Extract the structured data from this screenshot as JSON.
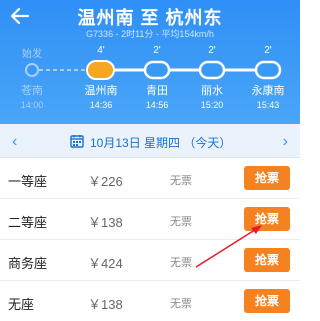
{
  "header": {
    "title": "温州南 至 杭州东",
    "subtitle": "G7336 - 2时11分 - 平均154km/h",
    "back_icon": "back-arrow-icon"
  },
  "route": {
    "stops": [
      {
        "name": "苍南",
        "time": "14:00",
        "stay": "始发",
        "passed": true
      },
      {
        "name": "温州南",
        "time": "14:36",
        "stay": "4'",
        "passed": false,
        "current": true
      },
      {
        "name": "青田",
        "time": "14:56",
        "stay": "2'",
        "passed": false
      },
      {
        "name": "丽水",
        "time": "15:20",
        "stay": "2'",
        "passed": false
      },
      {
        "name": "永康南",
        "time": "15:43",
        "stay": "2'",
        "passed": false
      }
    ],
    "colors": {
      "current": "#f5a623",
      "line": "#ffffff",
      "passed": "#a9d0fb"
    }
  },
  "datebar": {
    "prev_icon": "chevron-left-icon",
    "next_icon": "chevron-right-icon",
    "calendar_icon": "calendar-icon",
    "date": "10月13日 星期四 （今天）"
  },
  "seats": [
    {
      "type": "一等座",
      "price": "￥226",
      "availability": "无票",
      "action": "抢票"
    },
    {
      "type": "二等座",
      "price": "￥138",
      "availability": "无票",
      "action": "抢票"
    },
    {
      "type": "商务座",
      "price": "￥424",
      "availability": "无票",
      "action": "抢票"
    },
    {
      "type": "无座",
      "price": "￥138",
      "availability": "无票",
      "action": "抢票"
    }
  ],
  "colors": {
    "accent": "#f5821f",
    "header": "#3a98f6",
    "annotation": "#e8192c"
  }
}
